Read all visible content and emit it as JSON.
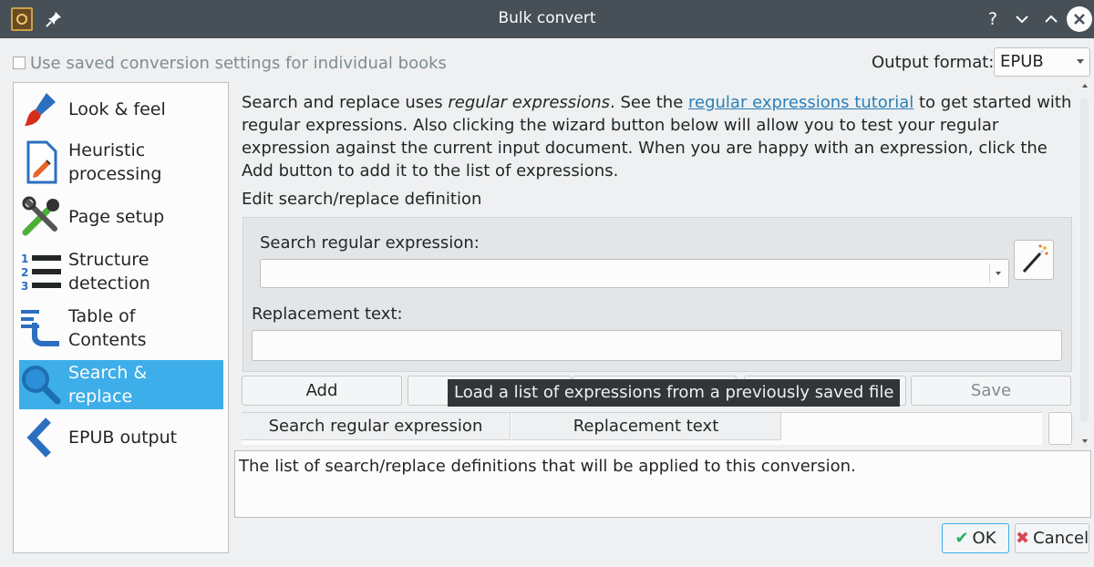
{
  "window": {
    "title": "Bulk convert"
  },
  "top": {
    "saved_settings_label": "Use saved conversion settings for individual books",
    "output_format_label": "Output format:",
    "output_format_value": "EPUB"
  },
  "sidebar": {
    "items": [
      {
        "label": "Look & feel",
        "icon": "brush-icon"
      },
      {
        "label": "Heuristic processing",
        "icon": "document-edit-icon"
      },
      {
        "label": "Page setup",
        "icon": "tools-icon"
      },
      {
        "label": "Structure detection",
        "icon": "numbered-list-icon"
      },
      {
        "label": "Table of Contents",
        "icon": "toc-icon"
      },
      {
        "label": "Search & replace",
        "icon": "magnifier-icon",
        "selected": true
      },
      {
        "label": "EPUB output",
        "icon": "chevron-left-icon"
      }
    ]
  },
  "content": {
    "intro_prefix": "Search and replace uses ",
    "intro_em": "regular expressions",
    "intro_mid": ". See the ",
    "intro_link": "regular expressions tutorial",
    "intro_suffix": " to get started with regular expressions. Also clicking the wizard button below will allow you to test your regular expression against the current input document. When you are happy with an expression, click the Add button to add it to the list of expressions.",
    "edit_label": "Edit search/replace definition",
    "search_label": "Search regular expression:",
    "search_value": "",
    "replacement_label": "Replacement text:",
    "replacement_value": ""
  },
  "buttons": {
    "add": "Add",
    "save": "Save",
    "ok": "OK",
    "cancel": "Cancel"
  },
  "tooltip": "Load a list of expressions from a previously saved file",
  "table": {
    "columns": [
      "Search regular expression",
      "Replacement text"
    ]
  },
  "description": "The list of search/replace definitions that will be applied to this conversion.",
  "colors": {
    "titlebar": "#475057",
    "selection": "#3daee9",
    "link": "#2980b9",
    "tooltip_bg": "#31363b"
  }
}
